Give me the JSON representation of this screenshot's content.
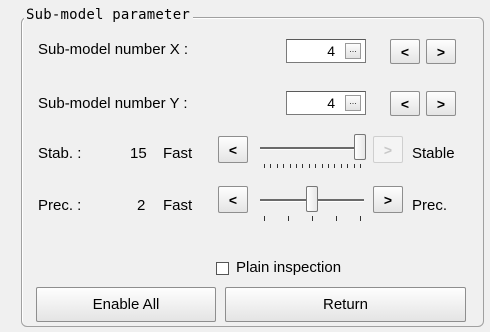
{
  "group_title": "Sub-model parameter",
  "submodel_x": {
    "label": "Sub-model number X :",
    "value": "4",
    "ellipsis": "...",
    "dec": "<",
    "inc": ">"
  },
  "submodel_y": {
    "label": "Sub-model number Y :",
    "value": "4",
    "ellipsis": "...",
    "dec": "<",
    "inc": ">"
  },
  "stab": {
    "label": "Stab. :",
    "value": "15",
    "left_text": "Fast",
    "right_text": "Stable",
    "dec": "<",
    "inc": ">",
    "inc_disabled": true,
    "level": 15,
    "max": 15
  },
  "prec": {
    "label": "Prec. :",
    "value": "2",
    "left_text": "Fast",
    "right_text": "Prec.",
    "dec": "<",
    "inc": ">",
    "level": 2,
    "max": 4
  },
  "plain_inspection": {
    "label": "Plain inspection",
    "checked": false
  },
  "buttons": {
    "enable_all": "Enable All",
    "return": "Return"
  }
}
